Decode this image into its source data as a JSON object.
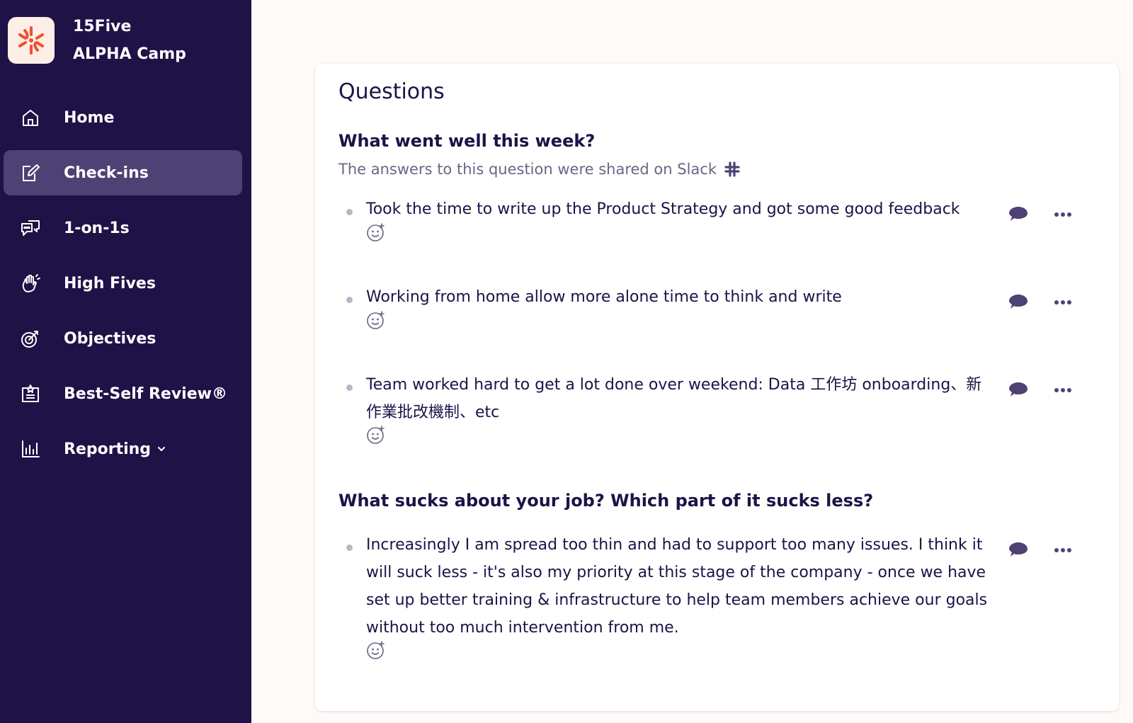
{
  "brand": {
    "line1": "15Five",
    "line2": "ALPHA Camp"
  },
  "nav": {
    "home": "Home",
    "checkins": "Check-ins",
    "one_on_ones": "1-on-1s",
    "high_fives": "High Fives",
    "objectives": "Objectives",
    "best_self_review": "Best-Self Review®",
    "reporting": "Reporting"
  },
  "colors": {
    "sidebar_bg": "#1e1247",
    "active_item": "#4d4273",
    "logo_accent": "#f0502e",
    "text_primary": "#1e1247"
  },
  "questions": {
    "section_title": "Questions",
    "q1": {
      "title": "What went well this week?",
      "subtitle": "The answers to this question were shared on Slack",
      "answers": [
        "Took the time to write up the Product Strategy and got some good feedback",
        "Working from home allow more alone time to think and write",
        "Team worked hard to get a lot done over  weekend: Data 工作坊 onboarding、新作業批改機制、etc"
      ]
    },
    "q2": {
      "title": "What sucks about your job? Which part of it sucks less?",
      "answers": [
        "Increasingly I am spread too thin and had to support too many issues. I think it will suck less - it's also my priority at this stage of the company - once we have set up better training & infrastructure to help team members achieve our goals without too much intervention from me."
      ]
    }
  }
}
